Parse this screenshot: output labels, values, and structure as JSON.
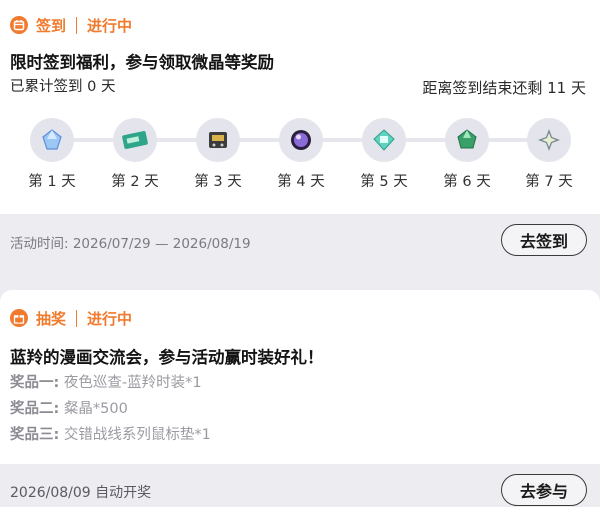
{
  "signin": {
    "tag": "签到",
    "status": "进行中",
    "title": "限时签到福利，参与领取微晶等奖励",
    "cumulative": "已累计签到 0 天",
    "countdown": "距离签到结束还剩 11 天",
    "days": [
      {
        "label": "第 1 天",
        "icon": "crystal-icon",
        "color": "#7fb2ee"
      },
      {
        "label": "第 2 天",
        "icon": "ticket-card-icon",
        "color": "#2fa58a"
      },
      {
        "label": "第 3 天",
        "icon": "device-box-icon",
        "color": "#4a4a4a"
      },
      {
        "label": "第 4 天",
        "icon": "purple-orb-icon",
        "color": "#6b4fb5"
      },
      {
        "label": "第 5 天",
        "icon": "teal-chip-icon",
        "color": "#49c4b0"
      },
      {
        "label": "第 6 天",
        "icon": "green-crystal-icon",
        "color": "#3aa06a"
      },
      {
        "label": "第 7 天",
        "icon": "star-shard-icon",
        "color": "#7b8a90"
      }
    ],
    "period": "活动时间: 2026/07/29 — 2026/08/19",
    "button": "去签到"
  },
  "lottery": {
    "tag": "抽奖",
    "status": "进行中",
    "title": "蓝羚的漫画交流会，参与活动赢时装好礼！",
    "prizes": [
      {
        "label": "奖品一:",
        "value": "夜色巡查-蓝羚时装*1"
      },
      {
        "label": "奖品二:",
        "value": "粲晶*500"
      },
      {
        "label": "奖品三:",
        "value": "交错战线系列鼠标垫*1"
      }
    ],
    "draw_time": "2026/08/09 自动开奖",
    "button": "去参与"
  },
  "colors": {
    "accent": "#f07b2e",
    "background": "#ececf1"
  }
}
